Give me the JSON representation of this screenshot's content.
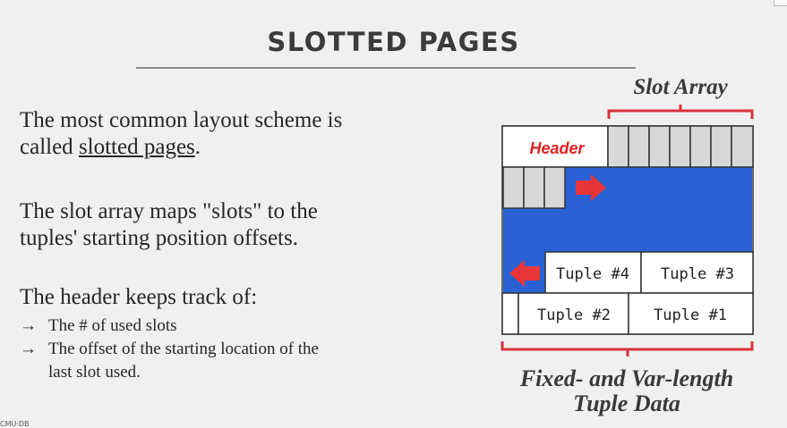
{
  "slide": {
    "title": "SLOTTED PAGES",
    "p1_line1": "The most common layout scheme is",
    "p1_line2_prefix": "called ",
    "p1_link": "slotted pages",
    "p1_line2_suffix": ".",
    "p2_line1": "The slot array maps \"slots\" to the",
    "p2_line2": "tuples' starting position offsets.",
    "p3": "The header keeps track of:",
    "bullet_symbol": "→",
    "bullet1": "The # of used slots",
    "bullet2_line1": "The offset of the starting location of the",
    "bullet2_line2": "last slot used.",
    "footer": "CMU·DB"
  },
  "diagram": {
    "slot_array_label": "Slot Array",
    "header_label": "Header",
    "tuples": [
      "Tuple #4",
      "Tuple #3",
      "Tuple #2",
      "Tuple #1"
    ],
    "bottom_label_line1": "Fixed- and Var-length",
    "bottom_label_line2": "Tuple Data",
    "colors": {
      "free_space": "#2a62d6",
      "arrow": "#e8353a",
      "bracket": "#d9323a",
      "slot_fill": "#d8d8d8",
      "header_text": "#e02020"
    }
  }
}
